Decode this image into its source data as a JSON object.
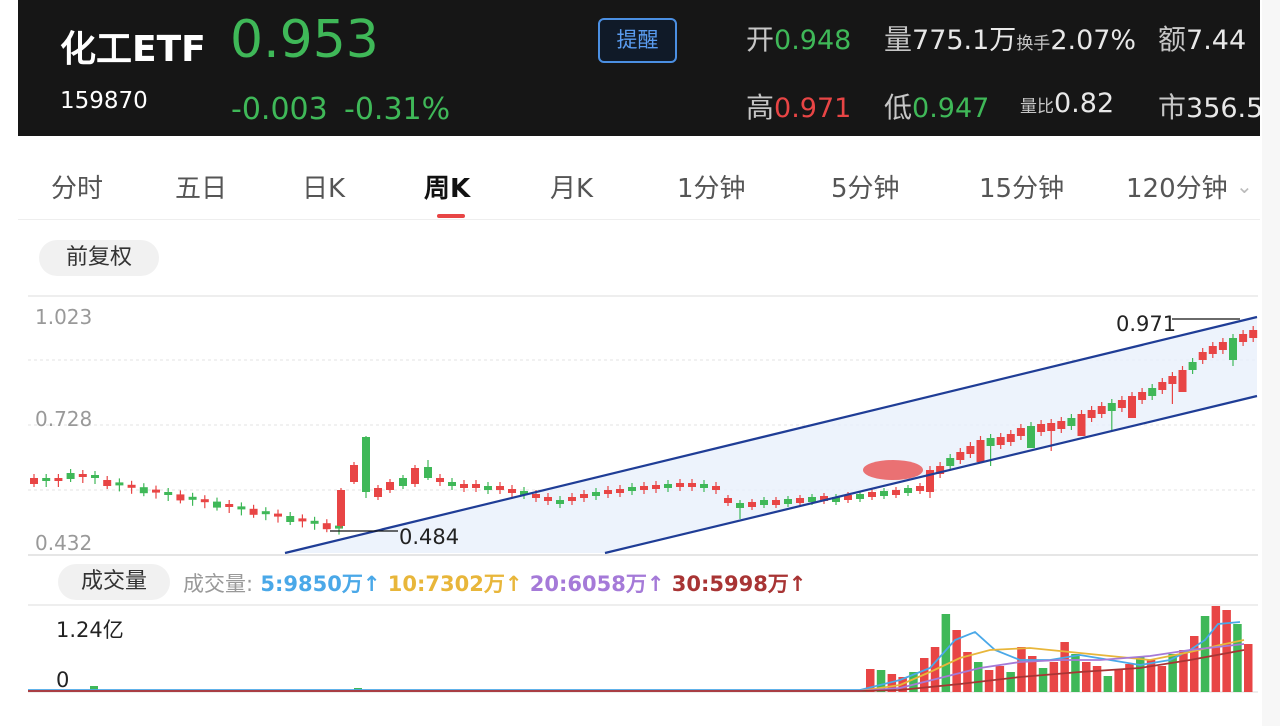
{
  "quote": {
    "name": "化工ETF",
    "code": "159870",
    "price": "0.953",
    "change": "-0.003",
    "change_pct": "-0.31%",
    "alert_label": "提醒",
    "open_label": "开",
    "open_value": "0.948",
    "volume_label": "量",
    "volume_value": "775.1万",
    "turnover_label": "换手",
    "turnover_value": "2.07%",
    "amount_label": "额",
    "amount_value": "7.44",
    "high_label": "高",
    "high_value": "0.971",
    "low_label": "低",
    "low_value": "0.947",
    "vol_ratio_label": "量比",
    "vol_ratio_value": "0.82",
    "mktcap_label": "市",
    "mktcap_value": "356.5"
  },
  "tabs": [
    "分时",
    "五日",
    "日K",
    "周K",
    "月K",
    "1分钟",
    "5分钟",
    "15分钟",
    "120分钟"
  ],
  "active_tab": "周K",
  "adjust_label": "前复权",
  "price_axis": {
    "top": "1.023",
    "mid": "0.728",
    "bottom": "0.432"
  },
  "annotations": {
    "high": "0.971",
    "low": "0.484"
  },
  "volume_section": {
    "label": "成交量",
    "legend_title": "成交量:",
    "ma5": "5:9850万↑",
    "ma10": "10:7302万↑",
    "ma20": "20:6058万↑",
    "ma30": "30:5998万↑",
    "axis_top": "1.24亿",
    "axis_bottom": "0"
  },
  "colors": {
    "up": "#e84545",
    "down": "#3fb858",
    "channel": "#1f3d96",
    "ma5": "#4aa8e8",
    "ma10": "#e8b63a",
    "ma20": "#a57ad8",
    "ma30": "#a83434"
  }
}
